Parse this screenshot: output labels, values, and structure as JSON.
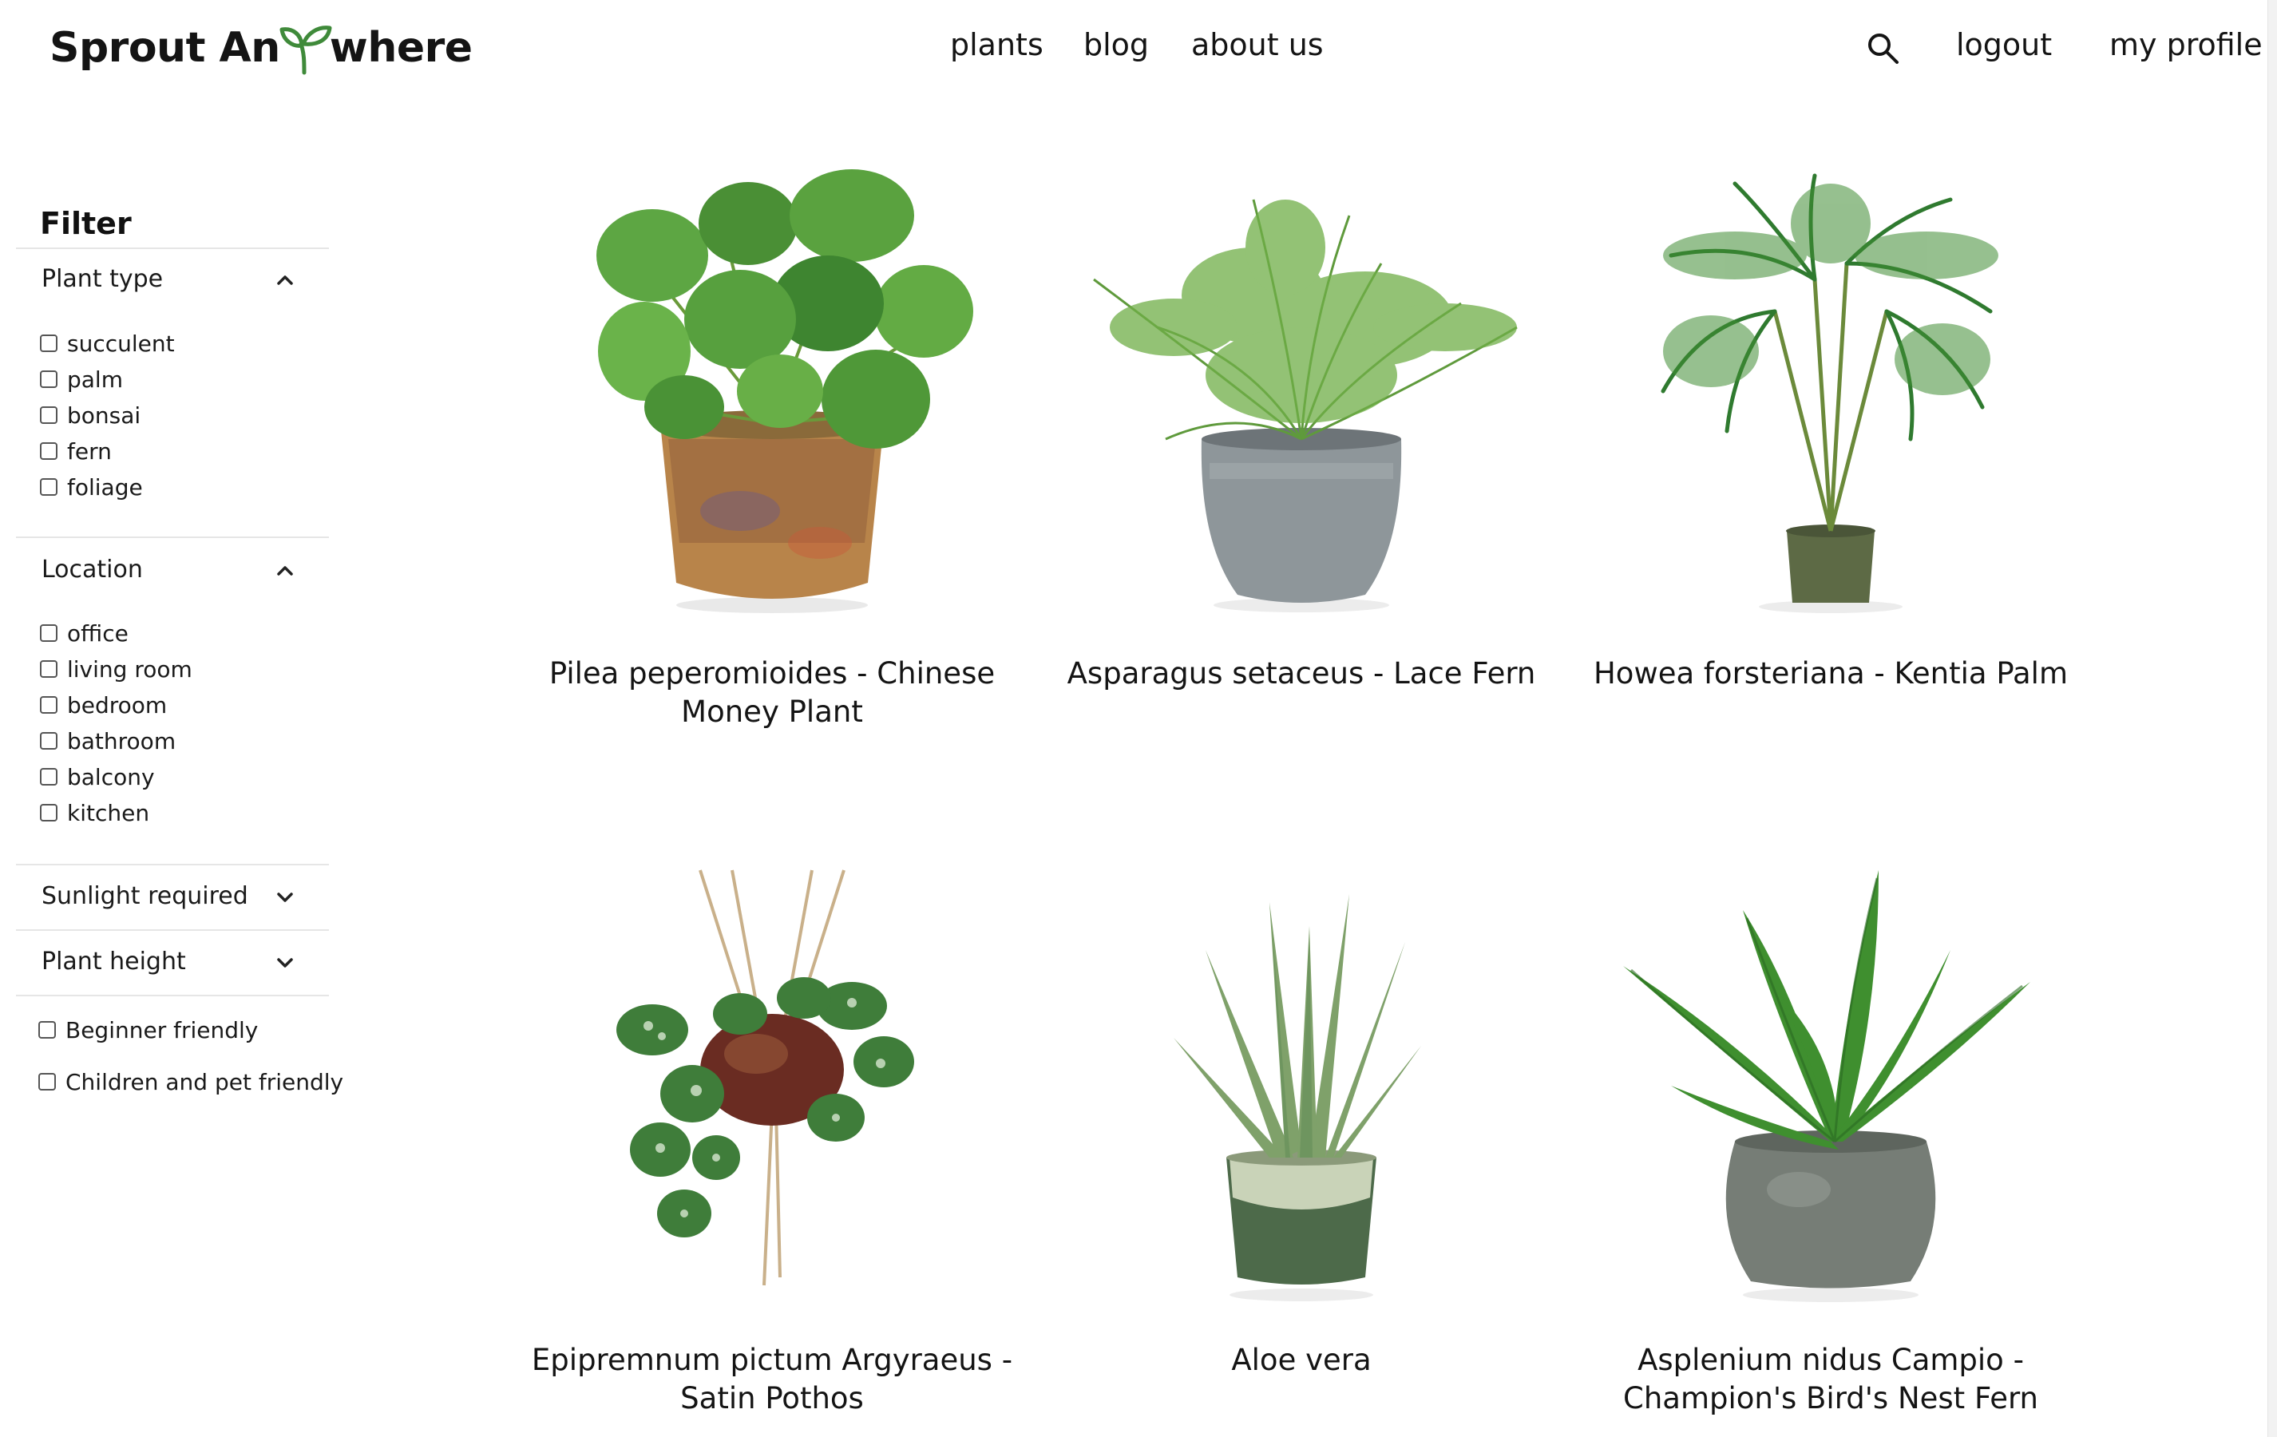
{
  "header": {
    "logo_left": "Sprout An",
    "logo_right": "where",
    "nav": [
      "plants",
      "blog",
      "about us"
    ],
    "search_icon": "search-icon",
    "logout": "logout",
    "profile": "my profile"
  },
  "filter": {
    "title": "Filter",
    "plant_type": {
      "label": "Plant type",
      "options": [
        "succulent",
        "palm",
        "bonsai",
        "fern",
        "foliage"
      ]
    },
    "location": {
      "label": "Location",
      "options": [
        "office",
        "living room",
        "bedroom",
        "bathroom",
        "balcony",
        "kitchen"
      ]
    },
    "sunlight": {
      "label": "Sunlight required"
    },
    "height": {
      "label": "Plant height"
    },
    "beginner": "Beginner friendly",
    "pet": "Children and pet friendly"
  },
  "products": [
    {
      "line1": "Pilea peperomioides - Chinese",
      "line2": "Money Plant"
    },
    {
      "line1": "Asparagus setaceus - Lace Fern",
      "line2": ""
    },
    {
      "line1": "Howea forsteriana - Kentia Palm",
      "line2": ""
    },
    {
      "line1": "Epipremnum pictum Argyraeus -",
      "line2": "Satin Pothos"
    },
    {
      "line1": "Aloe vera",
      "line2": ""
    },
    {
      "line1": "Asplenium nidus Campio -",
      "line2": "Champion's Bird's Nest Fern"
    }
  ],
  "colors": {
    "accent_green": "#3f8a3a",
    "text": "#141414",
    "divider": "#e6e6e6"
  }
}
